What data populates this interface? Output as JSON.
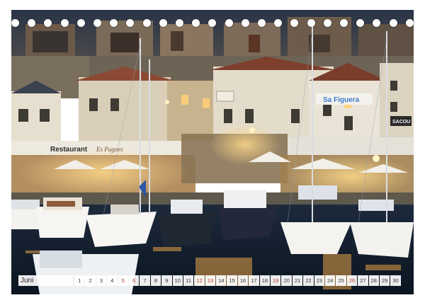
{
  "calendar": {
    "month": "Juni",
    "days": [
      {
        "d": "1",
        "sun": false
      },
      {
        "d": "2",
        "sun": false
      },
      {
        "d": "3",
        "sun": false
      },
      {
        "d": "4",
        "sun": false
      },
      {
        "d": "5",
        "sun": true
      },
      {
        "d": "6",
        "sun": true
      },
      {
        "d": "7",
        "sun": false
      },
      {
        "d": "8",
        "sun": false
      },
      {
        "d": "9",
        "sun": false
      },
      {
        "d": "10",
        "sun": false
      },
      {
        "d": "11",
        "sun": false
      },
      {
        "d": "12",
        "sun": true
      },
      {
        "d": "13",
        "sun": true
      },
      {
        "d": "14",
        "sun": false
      },
      {
        "d": "15",
        "sun": false
      },
      {
        "d": "16",
        "sun": false
      },
      {
        "d": "17",
        "sun": false
      },
      {
        "d": "18",
        "sun": false
      },
      {
        "d": "19",
        "sun": true
      },
      {
        "d": "20",
        "sun": false
      },
      {
        "d": "21",
        "sun": false
      },
      {
        "d": "22",
        "sun": false
      },
      {
        "d": "23",
        "sun": false
      },
      {
        "d": "24",
        "sun": false
      },
      {
        "d": "25",
        "sun": false
      },
      {
        "d": "26",
        "sun": true
      },
      {
        "d": "27",
        "sun": false
      },
      {
        "d": "28",
        "sun": false
      },
      {
        "d": "29",
        "sun": false
      },
      {
        "d": "30",
        "sun": false
      }
    ]
  },
  "photo": {
    "signs": {
      "restaurant": "Restaurant",
      "restaurant_script": "Es Pagoes",
      "right_shop": "Sa Figuera",
      "far_right": "SACOU"
    }
  },
  "colors": {
    "sky": "#1c2738",
    "water": "#0d1826",
    "warm_light": "#f3c26a",
    "weekend": "#c0392b"
  }
}
